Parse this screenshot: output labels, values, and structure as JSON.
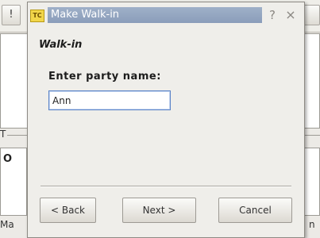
{
  "background_app": {
    "toolbar_left_label": "!",
    "frame_label": "T",
    "list_text": "O",
    "bottom_left_text": "Ma",
    "bottom_right_text": "n"
  },
  "dialog": {
    "title": "Make Walk-in",
    "app_icon_label": "TC",
    "help_glyph": "?",
    "close_glyph": "×",
    "page_heading": "Walk-in",
    "field_label": "Enter party name:",
    "party_name_value": "Ann",
    "buttons": {
      "back": "< Back",
      "next": "Next >",
      "cancel": "Cancel"
    }
  },
  "colors": {
    "title_highlight": "#8a9dba",
    "input_focus_border": "#5b84c8",
    "dialog_background": "#efeeea"
  }
}
